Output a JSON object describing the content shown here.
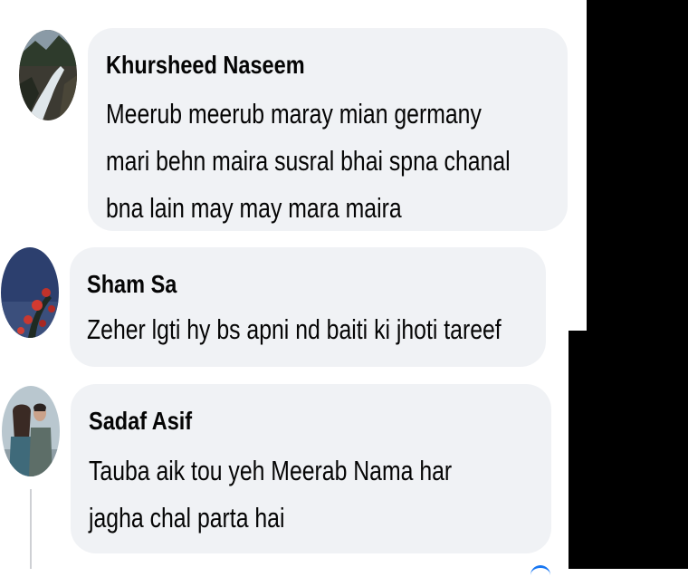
{
  "comments": [
    {
      "author": "Khursheed Naseem",
      "lines": [
        "Meerub meerub maray mian germany",
        "mari behn maira susral bhai spna chanal",
        "bna lain may may mara maira"
      ],
      "avatar": "waterfall-landscape-avatar"
    },
    {
      "author": "Sham Sa",
      "lines": [
        "Zeher lgti hy bs apni nd baiti ki jhoti tareef"
      ],
      "avatar": "flowers-dusk-avatar"
    },
    {
      "author": "Sadaf Asif",
      "lines": [
        "Tauba aik tou yeh Meerab Nama har",
        "jagha chal parta hai"
      ],
      "avatar": "couple-photo-avatar"
    }
  ],
  "colors": {
    "bubble": "#f0f2f5",
    "text": "#050505",
    "thread_line": "#ced0d4",
    "accent": "#1877f2"
  }
}
